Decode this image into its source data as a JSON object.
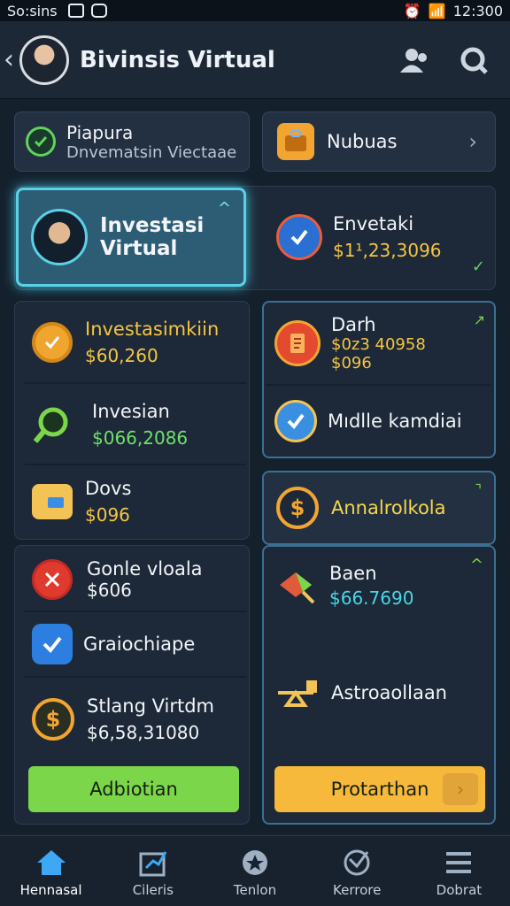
{
  "status": {
    "carrier": "So:sins",
    "time": "12:300"
  },
  "header": {
    "title": "Bivinsis Virtual"
  },
  "top_cards": [
    {
      "title": "Piapura",
      "subtitle": "Dnvematsin Viectaae"
    },
    {
      "title": "Nubuas"
    }
  ],
  "featured": {
    "title_line1": "Investasi",
    "title_line2": "Virtual"
  },
  "envetaki": {
    "title": "Envetaki",
    "value": "$1¹,23,3096"
  },
  "left_list": [
    {
      "title": "Investasimkiin",
      "value": "$60,260"
    },
    {
      "title": "Invesian",
      "value": "$066,2086"
    },
    {
      "title": "Dovs",
      "value": "$096"
    }
  ],
  "darh": {
    "title": "Darh",
    "value_line1": "$0z3 40958",
    "value_line2": "$096"
  },
  "middle": {
    "title": "Mıdlle kamdiai"
  },
  "annal": {
    "title": "Annalrolkola"
  },
  "bottom_left": [
    {
      "title": "Gonle vloala",
      "value": "$606"
    },
    {
      "title": "Graiochiape"
    },
    {
      "title": "Stlang Virtdm",
      "value": "$6,58,31080"
    }
  ],
  "bottom_right": [
    {
      "title": "Baen",
      "value": "$66.7690"
    },
    {
      "title": "Astroaollaan"
    }
  ],
  "buttons": {
    "green": "Adbiotian",
    "yellow": "Protarthan"
  },
  "nav": [
    {
      "label": "Hennasal"
    },
    {
      "label": "Cileris"
    },
    {
      "label": "Tenlon"
    },
    {
      "label": "Kerrore"
    },
    {
      "label": "Dobrat"
    }
  ],
  "colors": {
    "green": "#7cd64a",
    "yellow": "#f6b93b",
    "accent": "#5ad1e6",
    "bg": "#15202d"
  }
}
